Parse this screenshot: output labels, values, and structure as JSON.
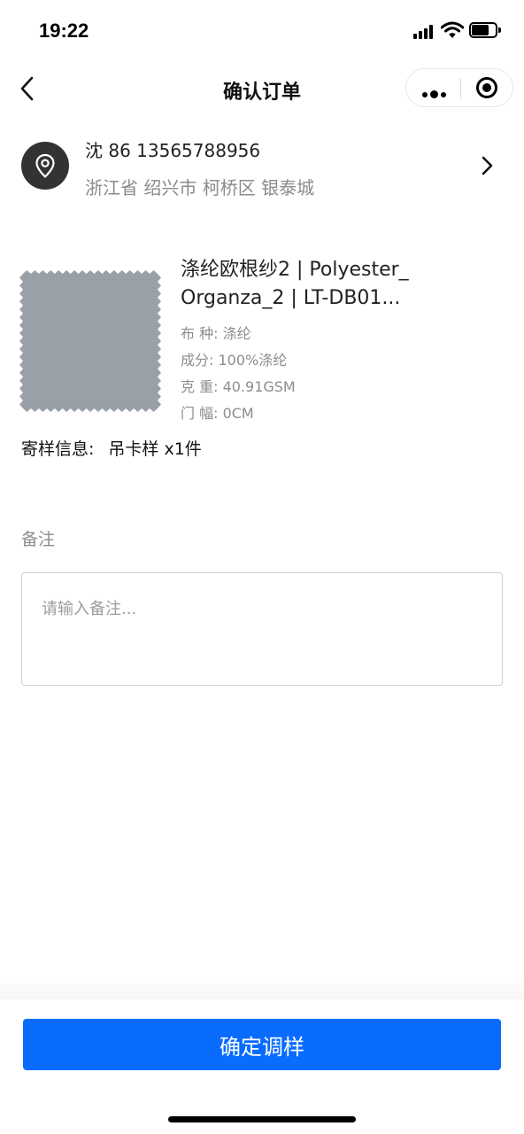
{
  "status_bar": {
    "time": "19:22"
  },
  "nav": {
    "title": "确认订单"
  },
  "address": {
    "name_phone": "沈 86 13565788956",
    "detail": "浙江省 绍兴市 柯桥区 银泰城"
  },
  "product": {
    "title_line1": "涤纶欧根纱2 | Polyester_",
    "title_line2": "Organza_2 | LT-DB01...",
    "specs": [
      "布 种: 涤纶",
      "成分: 100%涤纶",
      "克 重: 40.91GSM",
      "门 幅: 0CM"
    ],
    "swatch_color": "#9aa0a8"
  },
  "shipping": {
    "label": "寄样信息:",
    "value": "吊卡样 x1件"
  },
  "remark": {
    "label": "备注",
    "placeholder": "请输入备注..."
  },
  "confirm": {
    "label": "确定调样",
    "color": "#0a6cff"
  }
}
